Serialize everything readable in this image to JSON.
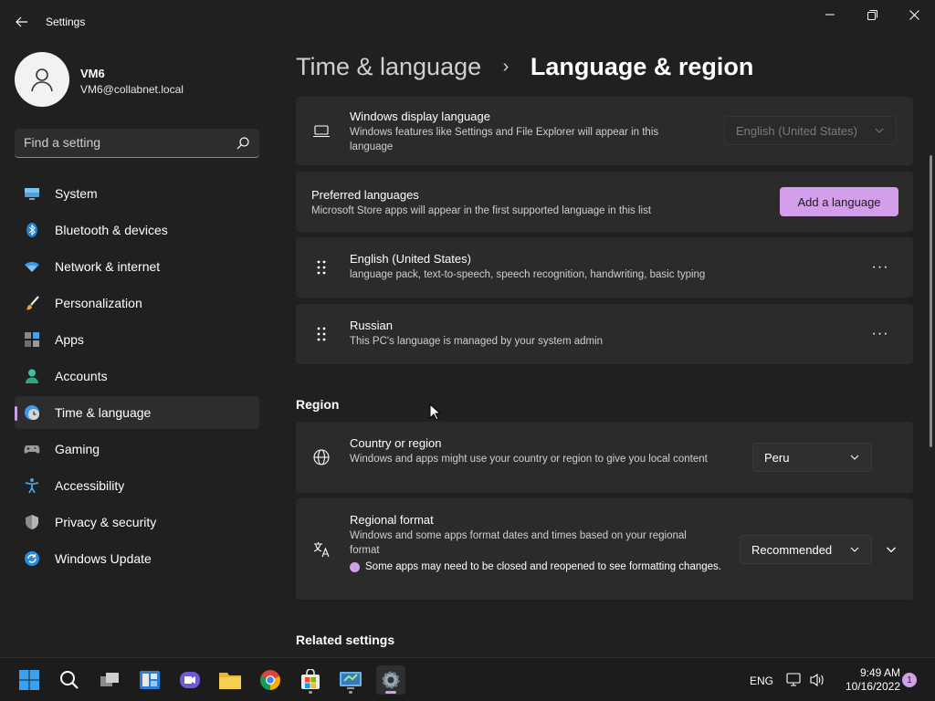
{
  "window": {
    "title": "Settings"
  },
  "profile": {
    "name": "VM6",
    "email": "VM6@collabnet.local"
  },
  "search": {
    "placeholder": "Find a setting"
  },
  "sidebar": {
    "items": [
      {
        "label": "System",
        "icon": "monitor-icon"
      },
      {
        "label": "Bluetooth & devices",
        "icon": "bluetooth-icon"
      },
      {
        "label": "Network & internet",
        "icon": "wifi-icon"
      },
      {
        "label": "Personalization",
        "icon": "brush-icon"
      },
      {
        "label": "Apps",
        "icon": "apps-icon"
      },
      {
        "label": "Accounts",
        "icon": "person-icon"
      },
      {
        "label": "Time & language",
        "icon": "globe-clock-icon",
        "active": true
      },
      {
        "label": "Gaming",
        "icon": "gamepad-icon"
      },
      {
        "label": "Accessibility",
        "icon": "accessibility-icon"
      },
      {
        "label": "Privacy & security",
        "icon": "shield-icon"
      },
      {
        "label": "Windows Update",
        "icon": "update-icon"
      }
    ]
  },
  "breadcrumb": {
    "parent": "Time & language",
    "separator": "›",
    "current": "Language & region"
  },
  "display_language": {
    "title": "Windows display language",
    "description": "Windows features like Settings and File Explorer will appear in this language",
    "value": "English (United States)"
  },
  "preferred_languages": {
    "title": "Preferred languages",
    "description": "Microsoft Store apps will appear in the first supported language in this list",
    "add_label": "Add a language",
    "items": [
      {
        "name": "English (United States)",
        "detail": "language pack, text-to-speech, speech recognition, handwriting, basic typing"
      },
      {
        "name": "Russian",
        "detail": "This PC's language is managed by your system admin"
      }
    ],
    "more_label": "···"
  },
  "region": {
    "section_title": "Region",
    "country": {
      "title": "Country or region",
      "description": "Windows and apps might use your country or region to give you local content",
      "value": "Peru"
    },
    "format": {
      "title": "Regional format",
      "description": "Windows and some apps format dates and times based on your regional format",
      "info": "Some apps may need to be closed and reopened to see formatting changes.",
      "value": "Recommended"
    }
  },
  "related_settings": {
    "title": "Related settings"
  },
  "taskbar": {
    "language": "ENG",
    "time": "9:49 AM",
    "date": "10/16/2022",
    "notification_count": "1"
  },
  "colors": {
    "accent": "#d39eea",
    "background": "#202020",
    "card": "#2b2b2b"
  }
}
